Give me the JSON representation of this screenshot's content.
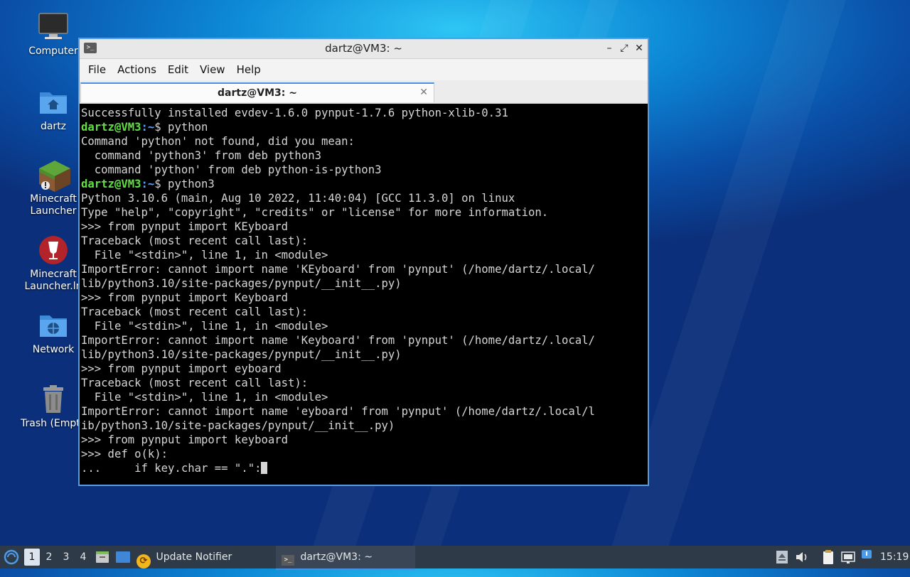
{
  "desktop": {
    "icons": [
      {
        "label": "Computer",
        "icon": "monitor-icon"
      },
      {
        "label": "dartz",
        "icon": "home-folder-icon"
      },
      {
        "label_lines": [
          "Minecraft",
          "Launcher"
        ],
        "icon": "minecraft-grass-block-icon"
      },
      {
        "label_lines": [
          "Minecraft",
          "Launcher.ln"
        ],
        "icon": "wine-icon"
      },
      {
        "label": "Network",
        "icon": "network-folder-icon"
      },
      {
        "label": "Trash (Empt",
        "icon": "trash-icon"
      }
    ]
  },
  "window": {
    "title": "dartz@VM3: ~",
    "controls": {
      "minimize": "–",
      "maximize": "⤢",
      "close": "✕"
    },
    "menu": [
      "File",
      "Actions",
      "Edit",
      "View",
      "Help"
    ],
    "tab": {
      "label": "dartz@VM3: ~",
      "close": "✕"
    }
  },
  "terminal": {
    "prompt_user": "dartz@VM3",
    "prompt_path": ":~",
    "lines": [
      {
        "text": "Successfully installed evdev-1.6.0 pynput-1.7.6 python-xlib-0.31"
      },
      {
        "prompt": true,
        "text": "$ python"
      },
      {
        "text": "Command 'python' not found, did you mean:"
      },
      {
        "text": "  command 'python3' from deb python3"
      },
      {
        "text": "  command 'python' from deb python-is-python3"
      },
      {
        "prompt": true,
        "text": "$ python3"
      },
      {
        "text": "Python 3.10.6 (main, Aug 10 2022, 11:40:04) [GCC 11.3.0] on linux"
      },
      {
        "text": "Type \"help\", \"copyright\", \"credits\" or \"license\" for more information."
      },
      {
        "text": ">>> from pynput import KEyboard"
      },
      {
        "text": "Traceback (most recent call last):"
      },
      {
        "text": "  File \"<stdin>\", line 1, in <module>"
      },
      {
        "text": "ImportError: cannot import name 'KEyboard' from 'pynput' (/home/dartz/.local/"
      },
      {
        "text": "lib/python3.10/site-packages/pynput/__init__.py)"
      },
      {
        "text": ">>> from pynput import Keyboard"
      },
      {
        "text": "Traceback (most recent call last):"
      },
      {
        "text": "  File \"<stdin>\", line 1, in <module>"
      },
      {
        "text": "ImportError: cannot import name 'Keyboard' from 'pynput' (/home/dartz/.local/"
      },
      {
        "text": "lib/python3.10/site-packages/pynput/__init__.py)"
      },
      {
        "text": ">>> from pynput import eyboard"
      },
      {
        "text": "Traceback (most recent call last):"
      },
      {
        "text": "  File \"<stdin>\", line 1, in <module>"
      },
      {
        "text": "ImportError: cannot import name 'eyboard' from 'pynput' (/home/dartz/.local/l"
      },
      {
        "text": "ib/python3.10/site-packages/pynput/__init__.py)"
      },
      {
        "text": ">>> from pynput import keyboard"
      },
      {
        "text": ">>> def o(k):"
      },
      {
        "text": "...     if key.char == \".\":",
        "cursor": true
      }
    ]
  },
  "taskbar": {
    "workspaces": [
      "1",
      "2",
      "3",
      "4"
    ],
    "active_workspace": "1",
    "launchers": [
      {
        "icon": "file-manager-icon"
      },
      {
        "icon": "show-desktop-icon"
      }
    ],
    "tasks": [
      {
        "label": "Update Notifier",
        "icon": "update-notifier-icon"
      },
      {
        "label": "dartz@VM3: ~",
        "icon": "terminal-icon"
      }
    ],
    "tray": [
      {
        "icon": "eject-icon"
      },
      {
        "icon": "volume-icon"
      },
      {
        "icon": "clipboard-icon"
      },
      {
        "icon": "network-connection-icon"
      },
      {
        "icon": "notification-icon"
      }
    ],
    "clock": "15:19"
  }
}
